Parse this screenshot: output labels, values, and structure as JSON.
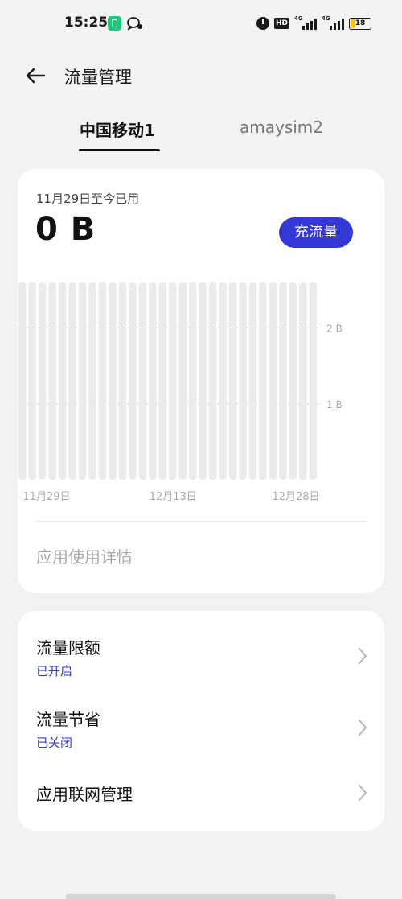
{
  "status_bar": {
    "time": "15:25",
    "icons": [
      "app-notification-icon",
      "wechat-icon",
      "alarm-icon",
      "hd-icon",
      "signal-4g-icon",
      "signal-4g-icon",
      "battery-icon"
    ],
    "hd_label": "HD",
    "network_label_1": "4G",
    "network_label_2": "4G",
    "battery_level": "18"
  },
  "header": {
    "title": "流量管理",
    "back_icon": "back-arrow-icon"
  },
  "sim_tabs": [
    {
      "label": "中国移动1",
      "active": true
    },
    {
      "label": "amaysim2",
      "active": false
    }
  ],
  "usage": {
    "period_label": "11月29日至今已用",
    "amount": "0 B",
    "recharge_label": "充流量",
    "app_detail_label": "应用使用详情"
  },
  "chart_data": {
    "type": "bar",
    "ylim": [
      0,
      2.6
    ],
    "y_tick_labels": [
      "2 B",
      "1 B"
    ],
    "y_tick_values": [
      2,
      1
    ],
    "x_tick_labels": [
      "11月29日",
      "12月13日",
      "12月28日"
    ],
    "bar_count": 30,
    "values": [
      0,
      0,
      0,
      0,
      0,
      0,
      0,
      0,
      0,
      0,
      0,
      0,
      0,
      0,
      0,
      0,
      0,
      0,
      0,
      0,
      0,
      0,
      0,
      0,
      0,
      0,
      0,
      0,
      0,
      0
    ],
    "grid": true,
    "bar_color": "#ebebeb"
  },
  "settings": [
    {
      "title": "流量限额",
      "status": "已开启"
    },
    {
      "title": "流量节省",
      "status": "已关闭"
    },
    {
      "title": "应用联网管理",
      "status": ""
    }
  ],
  "colors": {
    "accent": "#3338d6",
    "background": "#f2f2f2",
    "card": "#ffffff"
  }
}
